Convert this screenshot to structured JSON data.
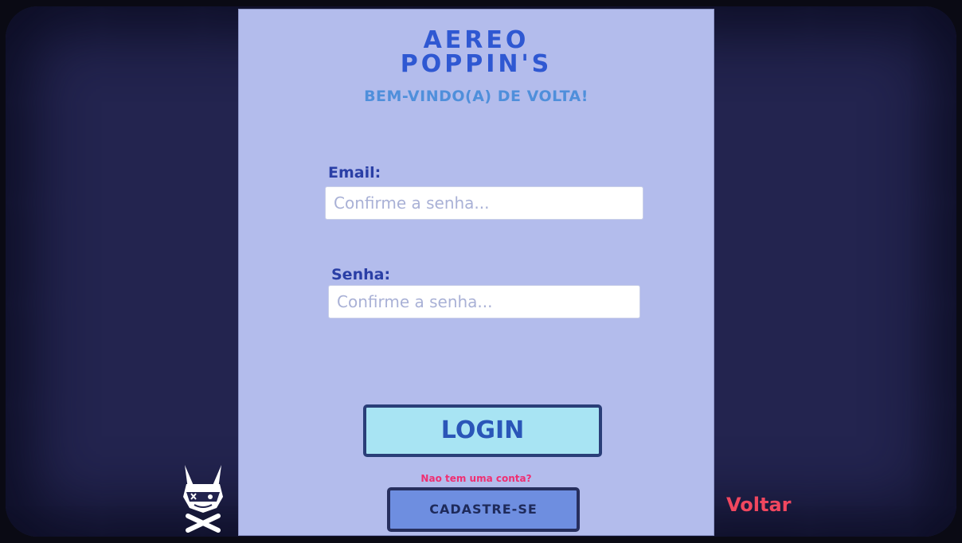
{
  "app": {
    "title_line1": "AEREO",
    "title_line2": "POPPIN'S",
    "subtitle": "BEM-VINDO(A) DE VOLTA!"
  },
  "form": {
    "email_label": "Email:",
    "email_placeholder": "Confirme a senha...",
    "email_value": "",
    "password_label": "Senha:",
    "password_placeholder": "Confirme a senha...",
    "password_value": ""
  },
  "actions": {
    "login_label": "LOGIN",
    "no_account_text": "Nao tem uma conta?",
    "signup_label": "CADASTRE-SE",
    "back_label": "Voltar"
  },
  "icons": {
    "mascot": "fox-mascot-icon"
  },
  "colors": {
    "background": "#23244f",
    "panel": "#b3bcec",
    "title": "#2f58d2",
    "subtitle": "#4f8fdb",
    "login_button": "#a8e4f3",
    "signup_button": "#6e8ee0",
    "accent_pink": "#ef2f72",
    "back_link": "#f0475f"
  }
}
